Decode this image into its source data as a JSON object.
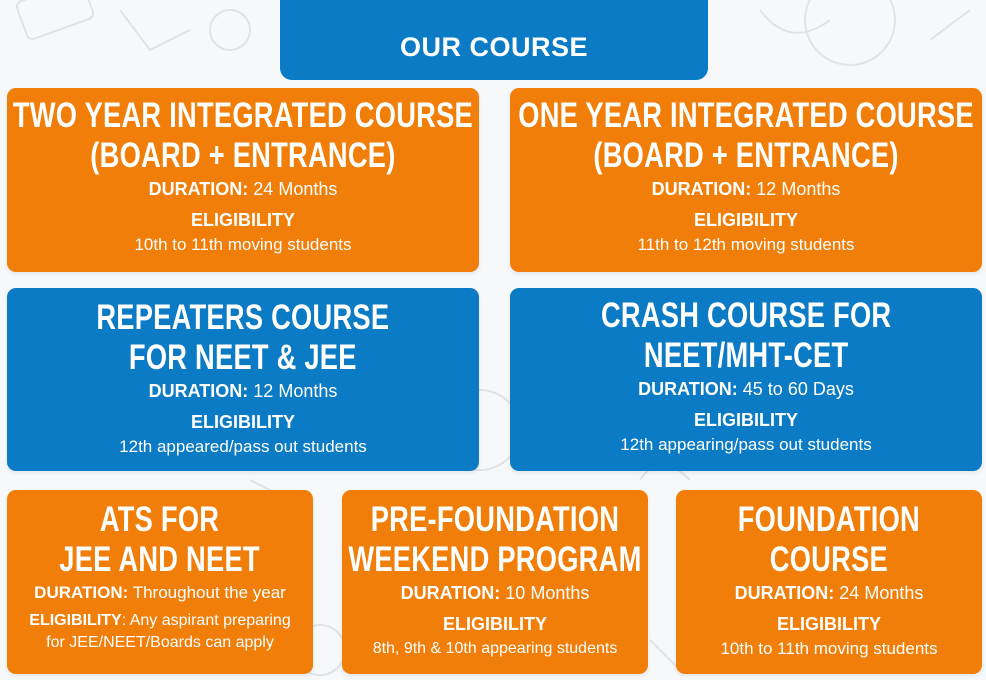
{
  "header": {
    "title": "OUR COURSE"
  },
  "colors": {
    "orange": "#f07e08",
    "blue": "#0a7bc4",
    "background": "#f7f8fa"
  },
  "cards": [
    {
      "title_line1": "TWO YEAR INTEGRATED COURSE",
      "title_line2": "(BOARD + ENTRANCE)",
      "duration_label": "DURATION:",
      "duration_value": " 24 Months",
      "eligibility_label": "ELIGIBILITY",
      "eligibility_value": "10th to 11th moving students"
    },
    {
      "title_line1": "ONE YEAR INTEGRATED COURSE",
      "title_line2": "(BOARD + ENTRANCE)",
      "duration_label": "DURATION:",
      "duration_value": " 12 Months",
      "eligibility_label": "ELIGIBILITY",
      "eligibility_value": "11th to 12th moving students"
    },
    {
      "title_line1": "REPEATERS COURSE",
      "title_line2": "FOR NEET & JEE",
      "duration_label": "DURATION:",
      "duration_value": " 12 Months",
      "eligibility_label": "ELIGIBILITY",
      "eligibility_value": "12th appeared/pass out students"
    },
    {
      "title_line1": "CRASH COURSE FOR",
      "title_line2": "NEET/MHT-CET",
      "duration_label": "DURATION:",
      "duration_value": " 45 to 60 Days",
      "eligibility_label": "ELIGIBILITY",
      "eligibility_value": "12th appearing/pass out students"
    },
    {
      "title_line1": "ATS FOR",
      "title_line2": "JEE AND NEET",
      "duration_label": "DURATION:",
      "duration_value": " Throughout the year",
      "eligibility_label": "ELIGIBILITY",
      "eligibility_value_line1": ": Any aspirant preparing",
      "eligibility_value_line2": "for JEE/NEET/Boards can apply"
    },
    {
      "title_line1": "PRE-FOUNDATION",
      "title_line2": "WEEKEND PROGRAM",
      "duration_label": "DURATION:",
      "duration_value": " 10 Months",
      "eligibility_label": "ELIGIBILITY",
      "eligibility_value": "8th, 9th & 10th appearing students"
    },
    {
      "title_line1": "FOUNDATION",
      "title_line2": "COURSE",
      "duration_label": "DURATION:",
      "duration_value": " 24 Months",
      "eligibility_label": "ELIGIBILITY",
      "eligibility_value": "10th to 11th moving students"
    }
  ]
}
